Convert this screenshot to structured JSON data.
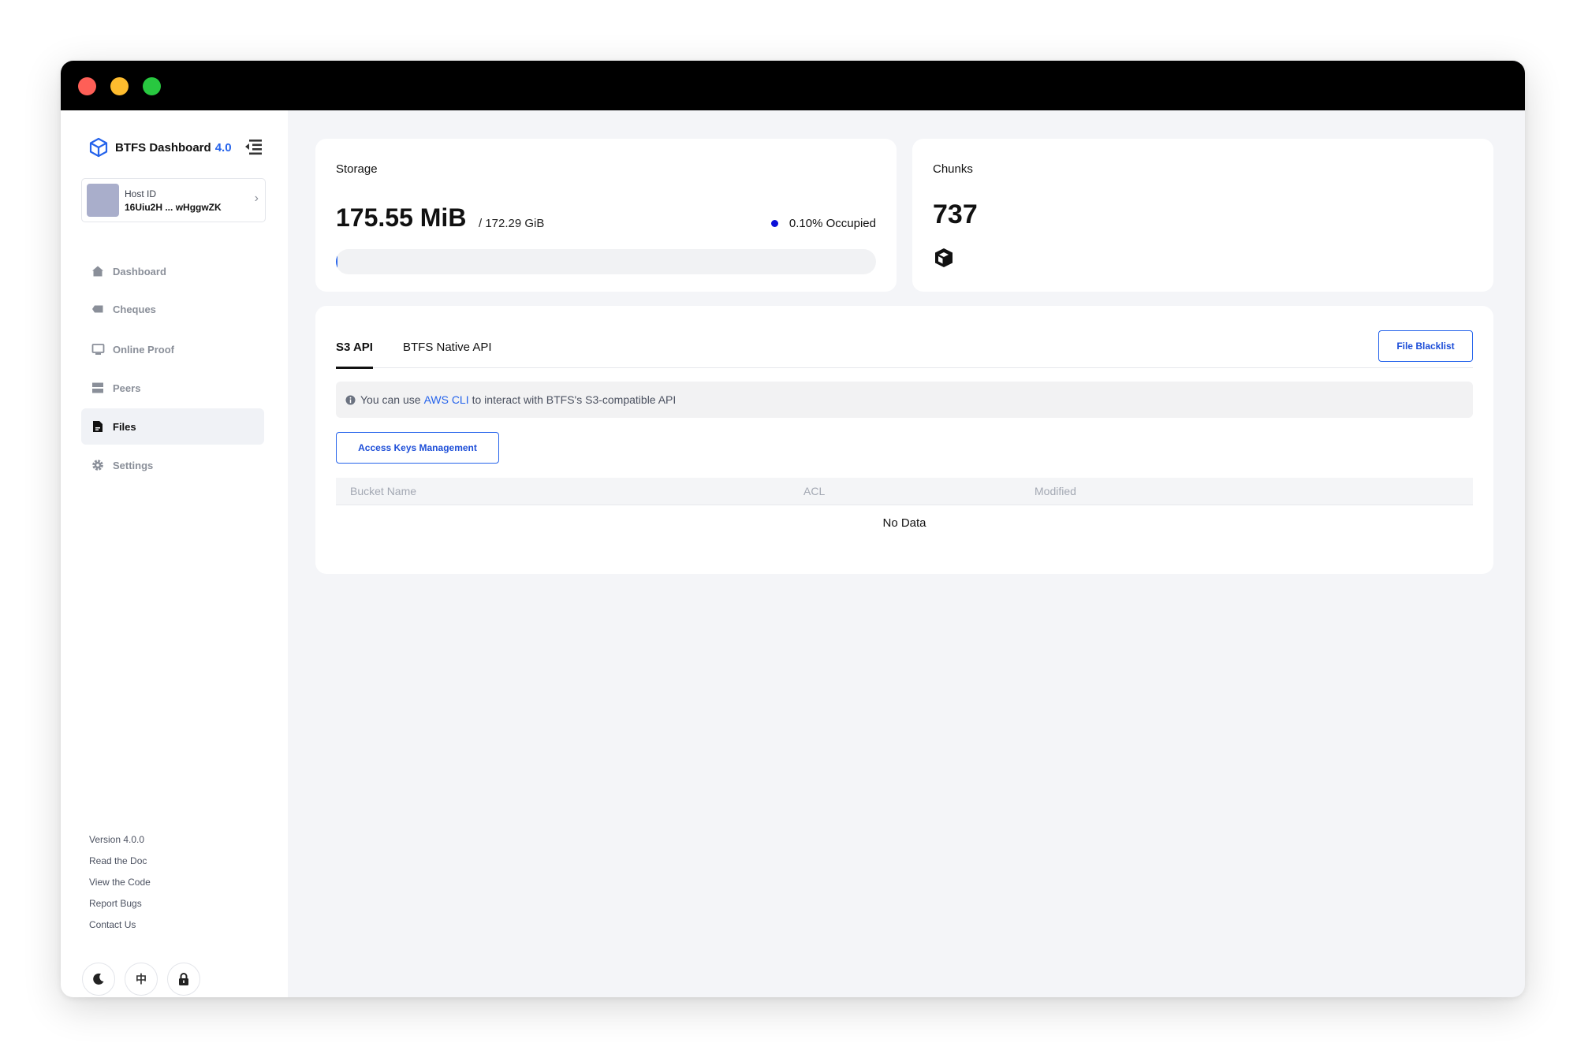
{
  "brand": {
    "name": "BTFS Dashboard",
    "version": "4.0",
    "accent_color": "#2563eb"
  },
  "host": {
    "label": "Host ID",
    "id": "16Uiu2H ... wHggwZK"
  },
  "sidebar": {
    "items": [
      {
        "label": "Dashboard",
        "icon": "home-icon",
        "active": false
      },
      {
        "label": "Cheques",
        "icon": "tag-icon",
        "active": false
      },
      {
        "label": "Online Proof",
        "icon": "monitor-icon",
        "active": false
      },
      {
        "label": "Peers",
        "icon": "server-icon",
        "active": false
      },
      {
        "label": "Files",
        "icon": "file-icon",
        "active": true
      },
      {
        "label": "Settings",
        "icon": "gear-icon",
        "active": false
      }
    ],
    "footer_links": [
      "Version 4.0.0",
      "Read the Doc",
      "View the Code",
      "Report Bugs",
      "Contact Us"
    ],
    "lang_toggle": "中",
    "theme_icon": "moon-icon",
    "lock_icon": "lock-icon"
  },
  "storage": {
    "title": "Storage",
    "used": "175.55 MiB",
    "total": "/ 172.29 GiB",
    "occupied_text": "0.10% Occupied",
    "occupied_fraction": 0.001
  },
  "chunks": {
    "title": "Chunks",
    "count": "737",
    "icon": "cube-icon"
  },
  "files": {
    "tabs": [
      "S3 API",
      "BTFS Native API"
    ],
    "active_tab": "S3 API",
    "blacklist_button": "File Blacklist",
    "info": {
      "prefix": "You can use",
      "link": "AWS CLI",
      "suffix": "to interact with BTFS's S3-compatible API"
    },
    "keys_button": "Access Keys Management",
    "table": {
      "columns": [
        "Bucket Name",
        "ACL",
        "Modified"
      ],
      "empty_text": "No Data"
    }
  }
}
